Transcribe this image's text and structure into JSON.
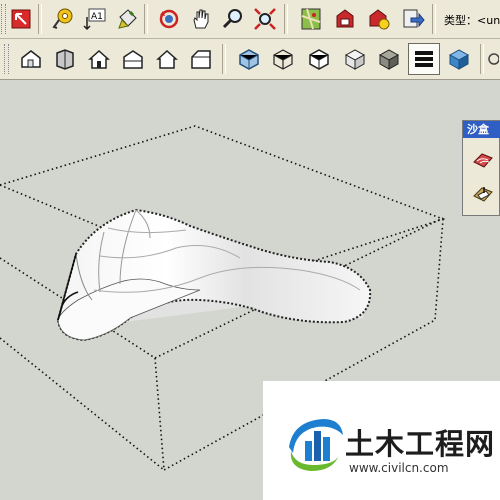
{
  "toolbar_top": {
    "buttons": [
      {
        "name": "select-red-icon"
      },
      {
        "name": "tape-measure-icon"
      },
      {
        "name": "dimension-text-icon",
        "label": "A1"
      },
      {
        "name": "paint-bucket-icon"
      },
      {
        "name": "orbit-icon"
      },
      {
        "name": "pan-hand-icon"
      },
      {
        "name": "zoom-icon"
      },
      {
        "name": "zoom-extents-icon"
      },
      {
        "name": "map-icon"
      },
      {
        "name": "warehouse-get-icon"
      },
      {
        "name": "share-component-icon"
      },
      {
        "name": "export-icon"
      }
    ],
    "type_label": "类型：<un"
  },
  "toolbar_views": {
    "buttons": [
      {
        "name": "iso-view-icon"
      },
      {
        "name": "top-view-icon"
      },
      {
        "name": "front-view-icon"
      },
      {
        "name": "right-view-icon"
      },
      {
        "name": "back-view-icon"
      },
      {
        "name": "left-view-icon"
      },
      {
        "name": "xray-style-icon"
      },
      {
        "name": "wireframe-style-icon"
      },
      {
        "name": "hidden-line-style-icon"
      },
      {
        "name": "shaded-style-icon"
      },
      {
        "name": "shaded-textures-style-icon",
        "pressed": true
      },
      {
        "name": "monochrome-style-icon"
      }
    ]
  },
  "sandbox_panel": {
    "title": "沙盒",
    "tools": [
      {
        "name": "sandbox-from-contours-icon"
      },
      {
        "name": "sandbox-from-scratch-icon"
      }
    ]
  },
  "watermark": {
    "title": "土木工程网",
    "url": "www.civilcn.com"
  },
  "colors": {
    "background": "#d3d6cf",
    "toolbar": "#ece9d8",
    "panel_title": "#2f5fc4",
    "watermark_blue": "#1e7fd0",
    "watermark_green": "#6ab82e"
  }
}
